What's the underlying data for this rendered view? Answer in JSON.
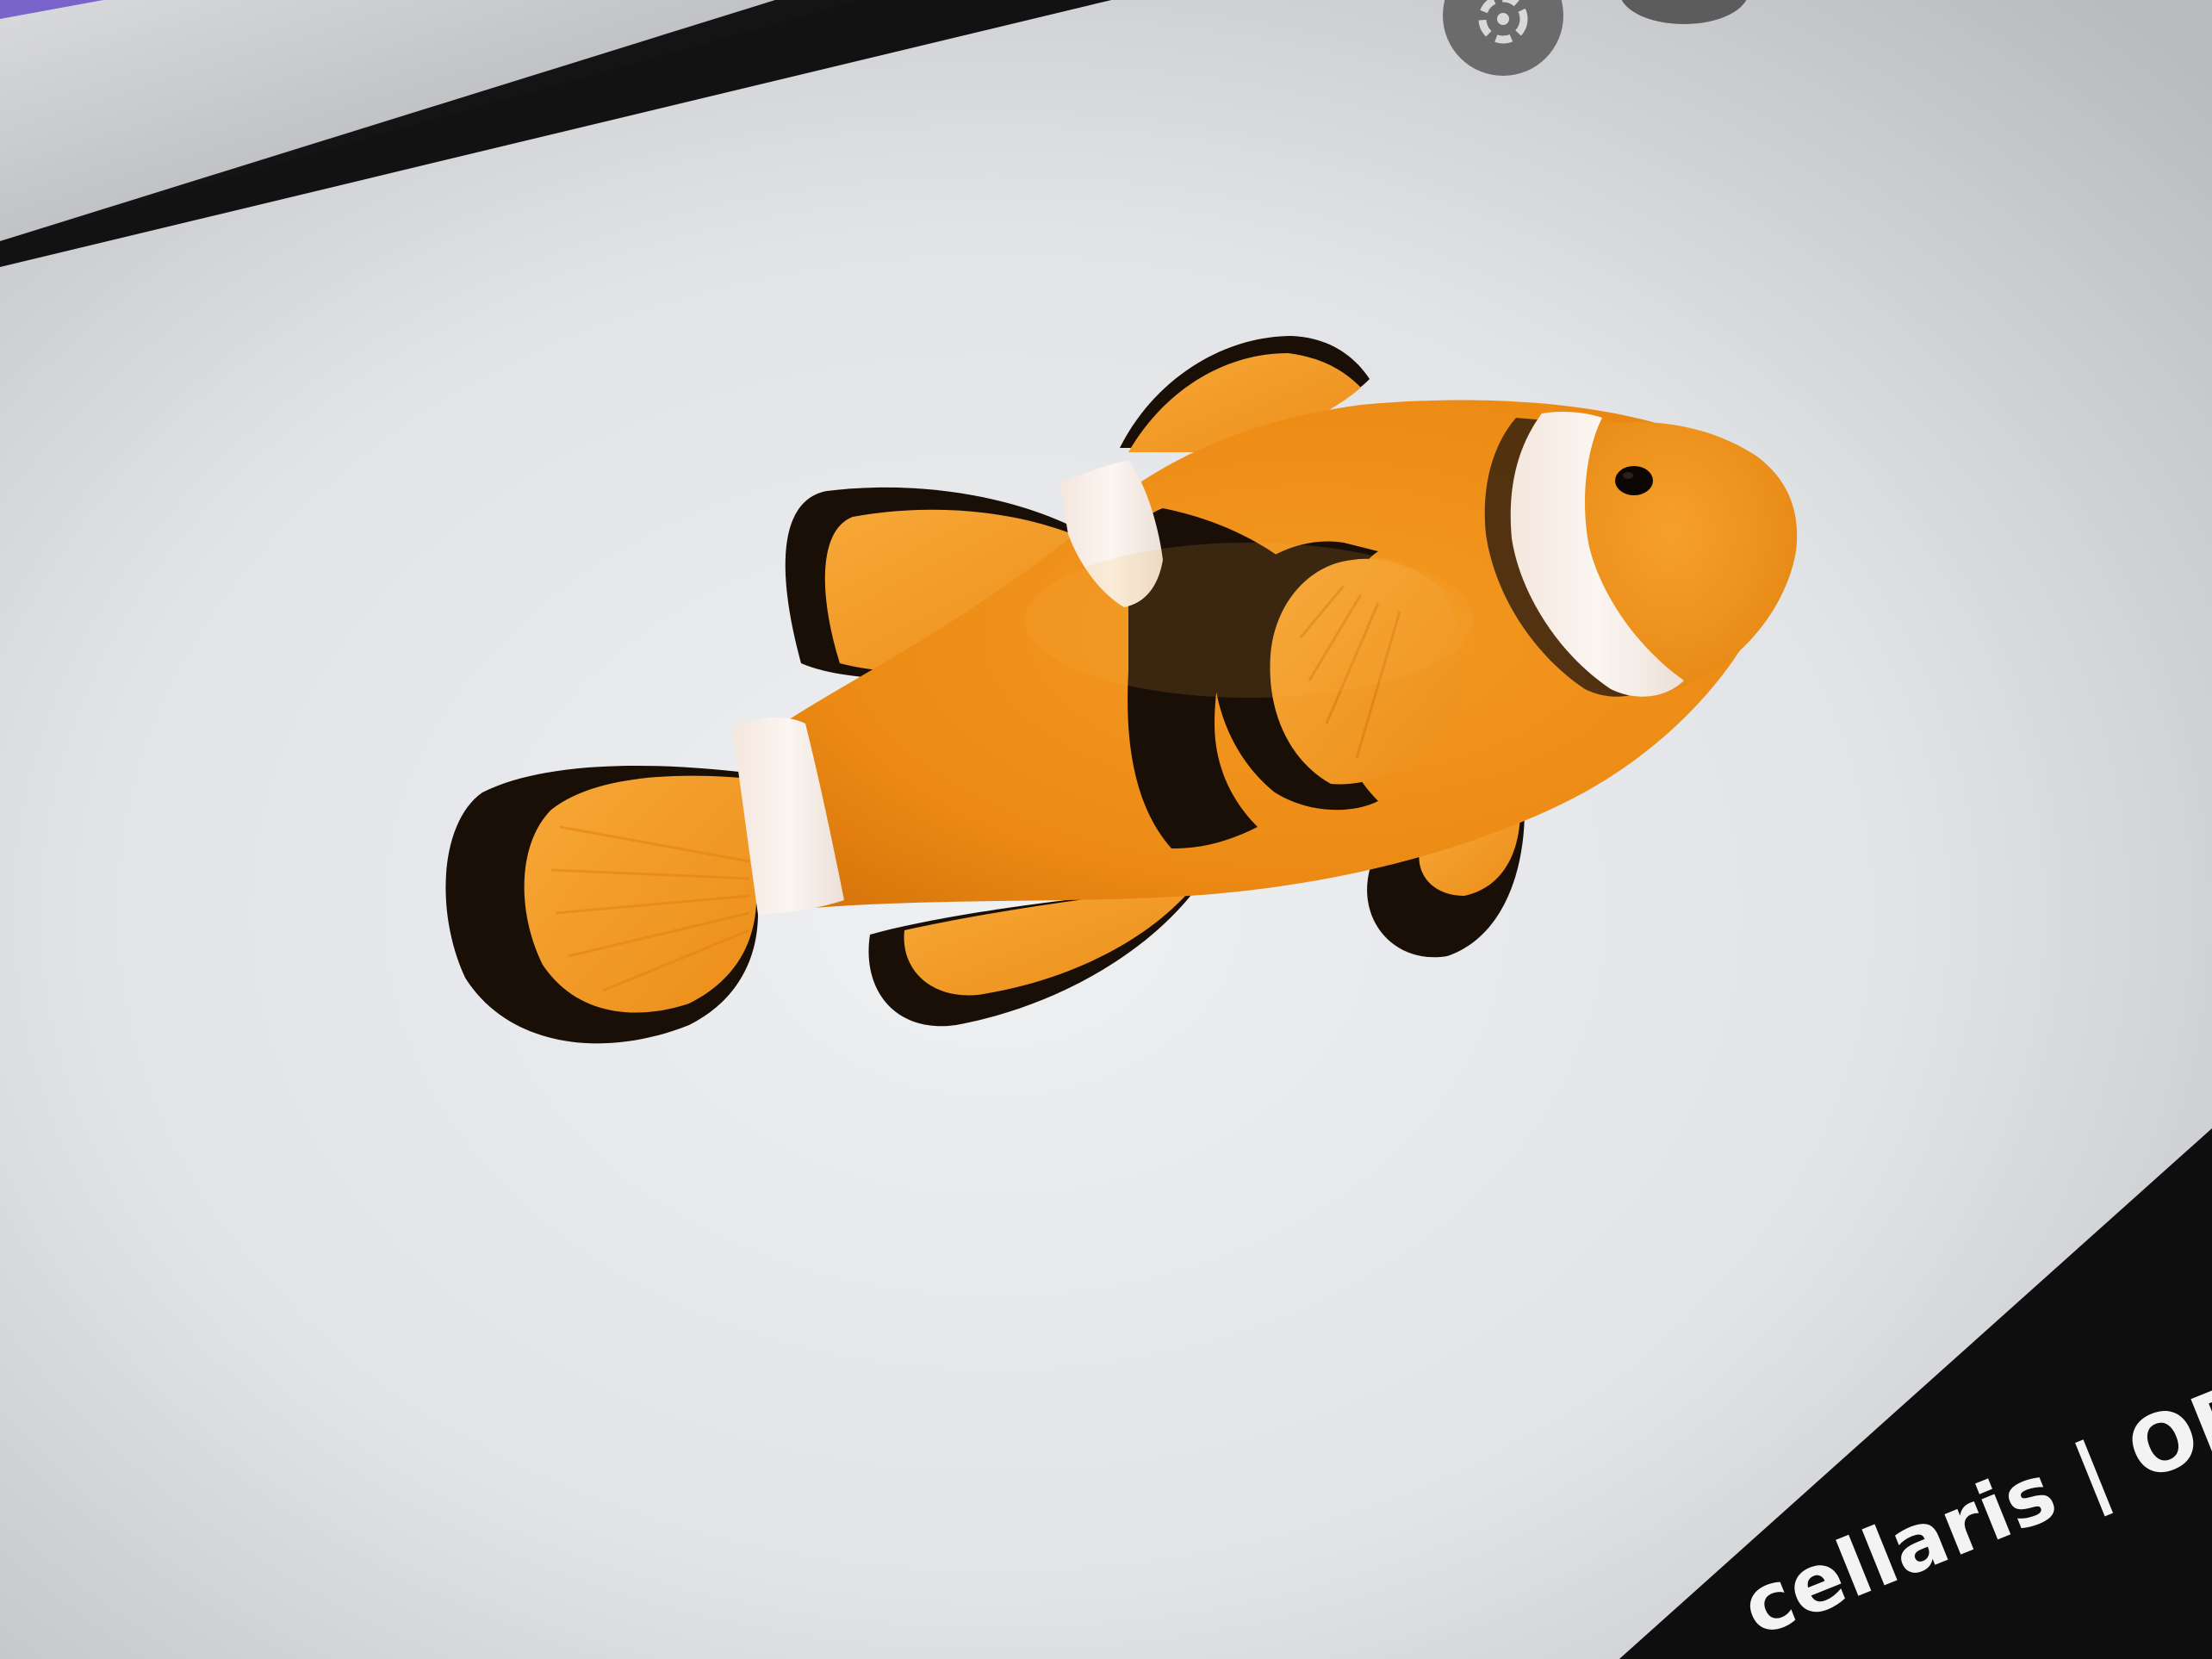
{
  "viewer": {
    "caption_text": "cellaris | ORA",
    "image_subject": "clownfish",
    "controls": [
      {
        "name": "lens-icon"
      },
      {
        "name": "more-options-icon"
      }
    ]
  },
  "colors": {
    "screen_background": "#e4e6e8",
    "bezel": "#141414",
    "fish_orange": "#f0921b",
    "fish_stripe": "#f7f0ea",
    "fish_black": "#1a0f07",
    "control_bg": "#6b6b6b",
    "accent_purple": "#6a50c8"
  }
}
